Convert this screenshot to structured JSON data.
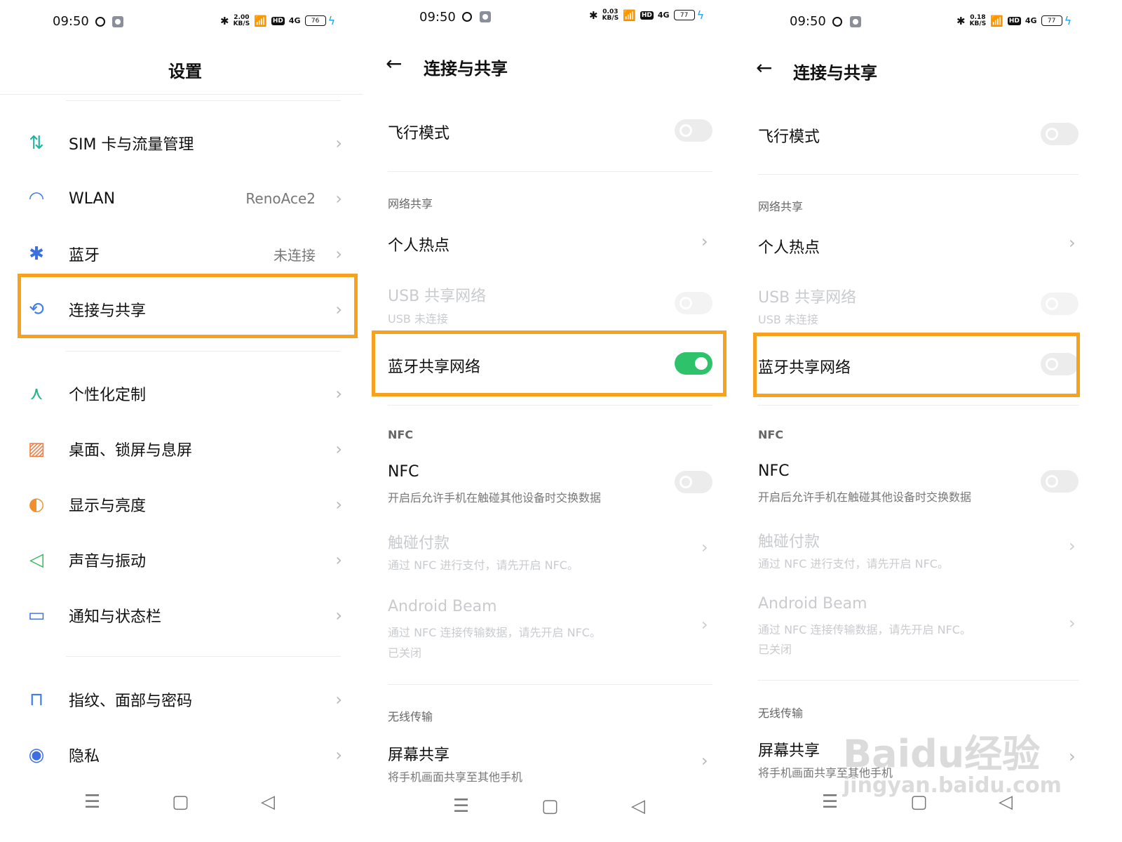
{
  "status": {
    "time": "09:50",
    "speeds": [
      [
        "2.00",
        "KB/S"
      ],
      [
        "0.03",
        "KB/S"
      ],
      [
        "0.18",
        "KB/S"
      ]
    ],
    "hd": "HD",
    "signal": "4G",
    "battery": [
      "76",
      "77",
      "77"
    ]
  },
  "settings": {
    "title": "设置",
    "items": [
      {
        "label": "SIM 卡与流量管理",
        "value": "",
        "icon": "sim-data-icon",
        "color": "#26b3a0"
      },
      {
        "label": "WLAN",
        "value": "RenoAce2",
        "icon": "wifi-icon",
        "color": "#3d7df0"
      },
      {
        "label": "蓝牙",
        "value": "未连接",
        "icon": "bluetooth-icon",
        "color": "#3d6fe0"
      },
      {
        "label": "连接与共享",
        "value": "",
        "icon": "connection-share-icon",
        "color": "#3d7df0"
      },
      {
        "label": "个性化定制",
        "value": "",
        "icon": "personalize-icon",
        "color": "#26b38a"
      },
      {
        "label": "桌面、锁屏与息屏",
        "value": "",
        "icon": "wallpaper-icon",
        "color": "#f07a3d"
      },
      {
        "label": "显示与亮度",
        "value": "",
        "icon": "brightness-icon",
        "color": "#f0902d"
      },
      {
        "label": "声音与振动",
        "value": "",
        "icon": "sound-icon",
        "color": "#2fb85a"
      },
      {
        "label": "通知与状态栏",
        "value": "",
        "icon": "notification-icon",
        "color": "#3d6fe0"
      },
      {
        "label": "指纹、面部与密码",
        "value": "",
        "icon": "lock-icon",
        "color": "#3d7df0"
      },
      {
        "label": "隐私",
        "value": "",
        "icon": "privacy-eye-icon",
        "color": "#3d6fe0"
      }
    ]
  },
  "conn": {
    "back": "←",
    "title": "连接与共享",
    "airplane": "飞行模式",
    "sec_net": "网络共享",
    "hotspot": "个人热点",
    "usb": "USB 共享网络",
    "usb_sub": "USB 未连接",
    "bt_tether": "蓝牙共享网络",
    "sec_nfc": "NFC",
    "nfc": "NFC",
    "nfc_sub": "开启后允许手机在触碰其他设备时交换数据",
    "tap_pay": "触碰付款",
    "tap_pay_sub": "通过 NFC 进行支付，请先开启 NFC。",
    "beam": "Android Beam",
    "beam_sub": "通过 NFC 连接传输数据，请先开启 NFC。",
    "beam_state": "已关闭",
    "sec_wireless": "无线传输",
    "screen_share": "屏幕共享",
    "screen_share_sub": "将手机画面共享至其他手机"
  },
  "toggles": {
    "p2": {
      "airplane": false,
      "usb": false,
      "bt_tether": true,
      "nfc": false
    },
    "p3": {
      "airplane": false,
      "usb": false,
      "bt_tether": false,
      "nfc": false
    }
  },
  "nav": {
    "menu": "☰",
    "home": "▢",
    "back": "◁"
  },
  "watermark": {
    "line1": "Baidu经验",
    "line2": "jingyan.baidu.com"
  },
  "colors": {
    "highlight": "#f7a21e",
    "toggle_on": "#2ec26a"
  }
}
